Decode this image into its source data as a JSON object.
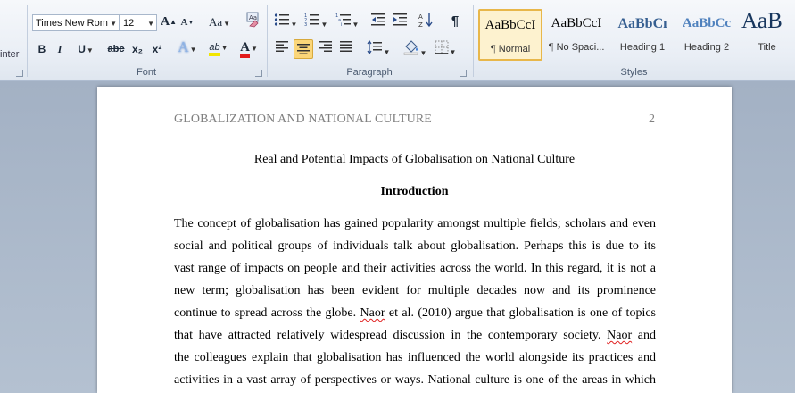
{
  "clipboard": {
    "partial_label": "inter"
  },
  "font": {
    "name": "Times New Rom",
    "size": "12",
    "grow_label": "A",
    "shrink_label": "A",
    "case_label": "Aa",
    "group_label": "Font",
    "bold": "B",
    "italic": "I",
    "underline": "U",
    "strike": "abc",
    "subscript": "x₂",
    "superscript": "x²",
    "effects": "A",
    "highlight": "ab",
    "color": "A"
  },
  "paragraph": {
    "group_label": "Paragraph",
    "pilcrow": "¶"
  },
  "styles": {
    "group_label": "Styles",
    "items": [
      {
        "sample": "AaBbCcI",
        "name": "¶ Normal"
      },
      {
        "sample": "AaBbCcI",
        "name": "¶ No Spaci..."
      },
      {
        "sample": "AaBbCı",
        "name": "Heading 1"
      },
      {
        "sample": "AaBbCc",
        "name": "Heading 2"
      },
      {
        "sample": "AaB",
        "name": "Title"
      }
    ]
  },
  "document": {
    "running_head": "GLOBALIZATION AND NATIONAL CULTURE",
    "page_number": "2",
    "title": "Real and Potential Impacts of Globalisation on National Culture",
    "heading": "Introduction",
    "lines": [
      "The concept of globalisation has gained popularity amongst multiple fields; scholars and even",
      "social and political groups of individuals talk about globalisation. Perhaps this is due to its",
      "vast range of impacts on people and their activities across the world. In this regard, it is not a",
      "new term; globalisation has been evident for multiple decades now and its prominence",
      "continue to spread across the globe. Naor et al. (2010) argue that globalisation is one of topics",
      "that have attracted relatively widespread discussion in the contemporary society. Naor and",
      "the colleagues explain that globalisation has influenced the world alongside its practices and",
      "activities in a vast array of perspectives or ways. National culture is one of the areas in which"
    ]
  },
  "colors": {
    "highlight": "#f2e600",
    "font_color": "#e21b1b",
    "selected_border": "#e8b74a"
  }
}
